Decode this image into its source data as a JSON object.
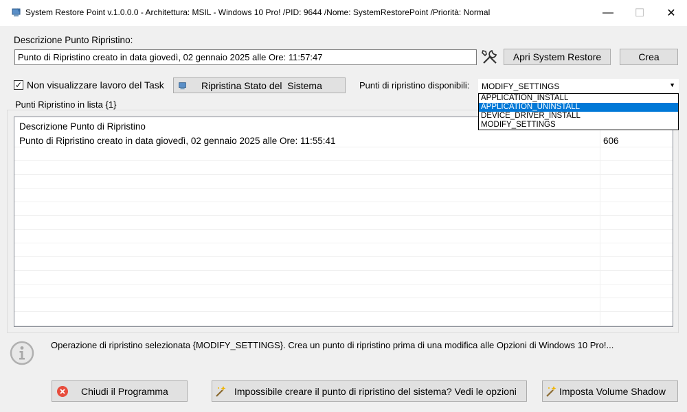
{
  "window": {
    "title": "System Restore Point v.1.0.0.0 - Architettura: MSIL - Windows 10 Pro! /PID: 9644 /Nome: SystemRestorePoint /Priorità: Normal",
    "minimize": "—",
    "maximize": "☐",
    "close": "✕"
  },
  "form": {
    "description_label": "Descrizione Punto Ripristino:",
    "description_value": "Punto di Ripristino creato in data giovedì, 02 gennaio 2025 alle Ore: 11:57:47",
    "open_restore_label": "Apri System Restore",
    "create_label": "Crea",
    "no_task_label": "Non visualizzare lavoro del Task",
    "no_task_checked": "✓",
    "restore_state_label": "Ripristina Stato del  Sistema",
    "available_points_label": "Punti di ripristino disponibili:",
    "combo_value": "MODIFY_SETTINGS",
    "combo_arrow": "▼",
    "combo_options": [
      "APPLICATION_INSTALL",
      "APPLICATION_UNINSTALL",
      "DEVICE_DRIVER_INSTALL",
      "MODIFY_SETTINGS"
    ],
    "combo_highlighted_index": 1
  },
  "list": {
    "group_label": "Punti Ripristino in lista {1}",
    "columns": [
      "Descrizione Punto di Ripristino",
      ""
    ],
    "rows": [
      [
        "Punto di Ripristino creato in data giovedì, 02 gennaio 2025 alle Ore: 11:55:41",
        "606"
      ]
    ]
  },
  "info": {
    "text": "Operazione di ripristino selezionata {MODIFY_SETTINGS}. Crea un punto di ripristino prima di una modifica alle Opzioni di Windows 10 Pro!..."
  },
  "footer": {
    "close_program_label": "Chiudi il Programma",
    "options_label": "Impossibile creare il punto di ripristino del sistema? Vedi le opzioni",
    "shadow_label": "Imposta Volume Shadow"
  },
  "colors": {
    "selection": "#0078d7",
    "close_icon": "#e74c3c"
  }
}
